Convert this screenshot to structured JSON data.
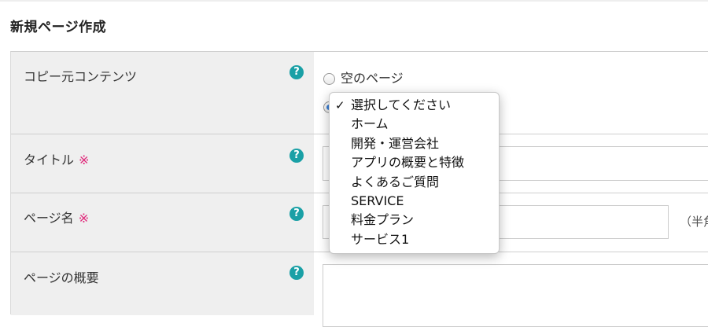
{
  "page": {
    "title": "新規ページ作成"
  },
  "form": {
    "copy_source": {
      "label": "コピー元コンテンツ",
      "help": "?",
      "radio_empty_label": "空のページ"
    },
    "title_field": {
      "label": "タイトル",
      "required_mark": "※",
      "help": "?"
    },
    "page_name_field": {
      "label": "ページ名",
      "required_mark": "※",
      "help": "?",
      "hint": "（半角"
    },
    "summary_field": {
      "label": "ページの概要",
      "help": "?"
    }
  },
  "dropdown": {
    "check_mark": "✓",
    "options": [
      "選択してください",
      "ホーム",
      "開発・運営会社",
      "アプリの概要と特徴",
      "よくあるご質問",
      "SERVICE",
      "料金プラン",
      "サービス1"
    ],
    "selected_index": 0
  },
  "colors": {
    "label_bg": "#efefef",
    "help_icon": "#1aa0a6",
    "required": "#e0277a",
    "radio_selected": "#3a7fd5"
  }
}
